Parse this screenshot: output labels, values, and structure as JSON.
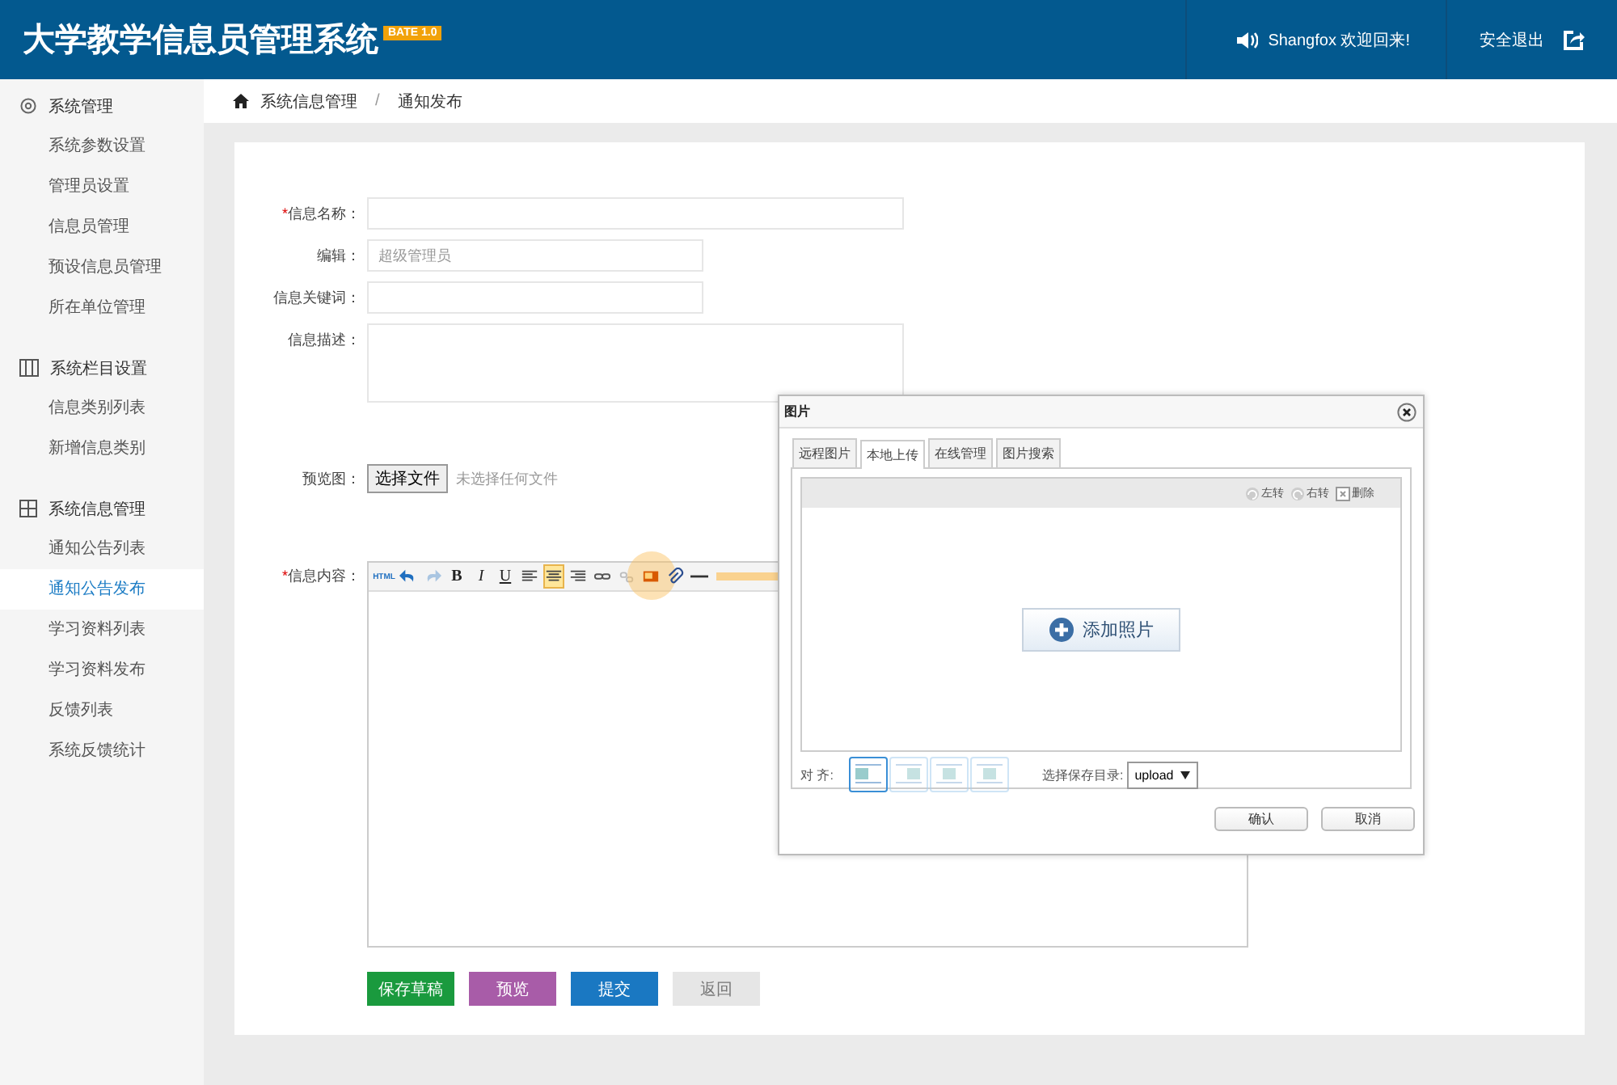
{
  "header": {
    "title": "大学教学信息员管理系统",
    "version_badge": "BATE 1.0",
    "welcome": "Shangfox 欢迎回来!",
    "logout": "安全退出"
  },
  "sidebar": {
    "groups": [
      {
        "title": "系统管理",
        "items": [
          {
            "label": "系统参数设置",
            "selected": false
          },
          {
            "label": "管理员设置",
            "selected": false
          },
          {
            "label": "信息员管理",
            "selected": false
          },
          {
            "label": "预设信息员管理",
            "selected": false
          },
          {
            "label": "所在单位管理",
            "selected": false
          }
        ]
      },
      {
        "title": "系统栏目设置",
        "items": [
          {
            "label": "信息类别列表",
            "selected": false
          },
          {
            "label": "新增信息类别",
            "selected": false
          }
        ]
      },
      {
        "title": "系统信息管理",
        "items": [
          {
            "label": "通知公告列表",
            "selected": false
          },
          {
            "label": "通知公告发布",
            "selected": true
          },
          {
            "label": "学习资料列表",
            "selected": false
          },
          {
            "label": "学习资料发布",
            "selected": false
          },
          {
            "label": "反馈列表",
            "selected": false
          },
          {
            "label": "系统反馈统计",
            "selected": false
          }
        ]
      }
    ]
  },
  "breadcrumb": {
    "separator": "/",
    "items": [
      "系统信息管理",
      "通知发布"
    ]
  },
  "form": {
    "required_mark": "*",
    "fields": [
      {
        "kind": "text",
        "label": "信息名称：",
        "required": true,
        "wide": true
      },
      {
        "kind": "text",
        "label": "编辑：",
        "required": false,
        "wide": false,
        "value": "超级管理员"
      },
      {
        "kind": "text",
        "label": "信息关键词：",
        "required": false,
        "wide": false
      },
      {
        "kind": "textarea",
        "label": "信息描述：",
        "required": false,
        "wide": true
      },
      {
        "kind": "file",
        "label": "预览图：",
        "required": false,
        "button": "选择文件",
        "status": "未选择任何文件"
      },
      {
        "kind": "editor",
        "label": "信息内容：",
        "required": true
      }
    ],
    "toolbar": [
      {
        "kind": "html",
        "label": "HTML",
        "selected": false,
        "disabled": false,
        "highlighted": false
      },
      {
        "kind": "undo",
        "selected": false,
        "disabled": false,
        "highlighted": false
      },
      {
        "kind": "redo",
        "selected": false,
        "disabled": true,
        "highlighted": false
      },
      {
        "kind": "bold",
        "label": "B",
        "selected": false,
        "disabled": false,
        "highlighted": false
      },
      {
        "kind": "italic",
        "label": "I",
        "selected": false,
        "disabled": false,
        "highlighted": false
      },
      {
        "kind": "underline",
        "label": "U",
        "selected": false,
        "disabled": false,
        "highlighted": false
      },
      {
        "kind": "align-left",
        "selected": false,
        "disabled": false,
        "highlighted": false
      },
      {
        "kind": "align-center",
        "selected": true,
        "disabled": false,
        "highlighted": false
      },
      {
        "kind": "align-right",
        "selected": false,
        "disabled": false,
        "highlighted": false
      },
      {
        "kind": "link",
        "selected": false,
        "disabled": false,
        "highlighted": false
      },
      {
        "kind": "unlink",
        "selected": false,
        "disabled": true,
        "highlighted": false
      },
      {
        "kind": "image",
        "selected": false,
        "disabled": false,
        "highlighted": true
      },
      {
        "kind": "attachment",
        "selected": false,
        "disabled": false,
        "highlighted": false
      },
      {
        "kind": "rule",
        "selected": false,
        "disabled": false,
        "highlighted": false
      }
    ],
    "buttons": [
      {
        "label": "保存草稿",
        "kind": "save",
        "disabled": false
      },
      {
        "label": "预览",
        "kind": "preview",
        "disabled": false
      },
      {
        "label": "提交",
        "kind": "submit",
        "disabled": false
      },
      {
        "label": "返回",
        "kind": "back",
        "disabled": true
      }
    ]
  },
  "dialog": {
    "title": "图片",
    "tabs": [
      {
        "label": "远程图片",
        "selected": false
      },
      {
        "label": "本地上传",
        "selected": true
      },
      {
        "label": "在线管理",
        "selected": false
      },
      {
        "label": "图片搜索",
        "selected": false
      }
    ],
    "actions": [
      {
        "kind": "rotate-left",
        "label": "左转"
      },
      {
        "kind": "rotate-right",
        "label": "右转"
      },
      {
        "kind": "delete",
        "label": "删除"
      }
    ],
    "add_button": "添加照片",
    "align_label": "对 齐:",
    "align_options": [
      {
        "selected": true
      },
      {
        "selected": false
      },
      {
        "selected": false
      },
      {
        "selected": false
      }
    ],
    "dir_label": "选择保存目录:",
    "dir_value": "upload",
    "buttons": [
      "确认",
      "取消"
    ]
  }
}
